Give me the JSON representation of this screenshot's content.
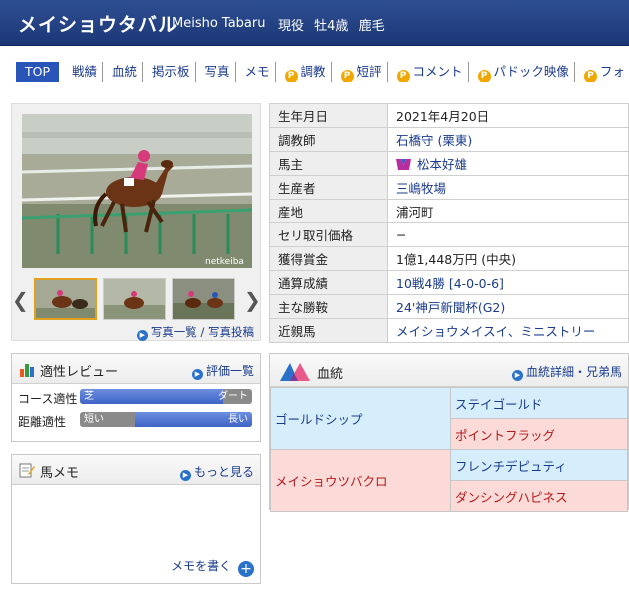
{
  "header": {
    "name_ja": "メイショウタバル",
    "name_en": "Meisho Tabaru",
    "status": "現役",
    "sex_age": "牡4歳",
    "coat": "鹿毛"
  },
  "nav": {
    "top": "TOP",
    "items": [
      "戦績",
      "血統",
      "掲示板",
      "写真",
      "メモ"
    ],
    "premium_items": [
      "調教",
      "短評",
      "コメント",
      "パドック映像",
      "フォトパドック"
    ],
    "premium_badge": "P"
  },
  "photo": {
    "watermark": "netkeiba",
    "links": "写真一覧 / 写真投稿"
  },
  "profile": {
    "rows": [
      {
        "key": "生年月日",
        "value": "2021年4月20日"
      },
      {
        "key": "調教師",
        "value": "石橋守 (栗東)"
      },
      {
        "key": "馬主",
        "value": "松本好雄"
      },
      {
        "key": "生産者",
        "value": "三嶋牧場"
      },
      {
        "key": "産地",
        "value": "浦河町"
      },
      {
        "key": "セリ取引価格",
        "value": "−"
      },
      {
        "key": "獲得賞金",
        "value": "1億1,448万円 (中央)"
      },
      {
        "key": "通算成績",
        "value": "10戦4勝 [4-0-0-6]"
      },
      {
        "key": "主な勝鞍",
        "value": "24'神戸新聞杯(G2)"
      },
      {
        "key": "近親馬",
        "value": "メイショウメイスイ、ミニストリー"
      }
    ]
  },
  "aptitude": {
    "title": "適性レビュー",
    "link": "評価一覧",
    "course_label": "コース適性",
    "course_left": "芝",
    "course_right": "ダート",
    "course_value": 0.83,
    "distance_label": "距離適性",
    "distance_left": "短い",
    "distance_right": "長い",
    "distance_value": 0.32
  },
  "memo": {
    "title": "馬メモ",
    "link": "もっと見る",
    "write": "メモを書く"
  },
  "pedigree": {
    "title": "血統",
    "link": "血統詳細・兄弟馬",
    "sire": "ゴールドシップ",
    "sire_sire": "ステイゴールド",
    "sire_dam": "ポイントフラッグ",
    "dam": "メイショウツバクロ",
    "dam_sire": "フレンチデピュティ",
    "dam_dam": "ダンシングハピネス"
  },
  "colors": {
    "header_bg": "#1b3776",
    "sire_bg": "#d6eefb",
    "dam_bg": "#fbdad8",
    "premium": "#f0a800"
  }
}
